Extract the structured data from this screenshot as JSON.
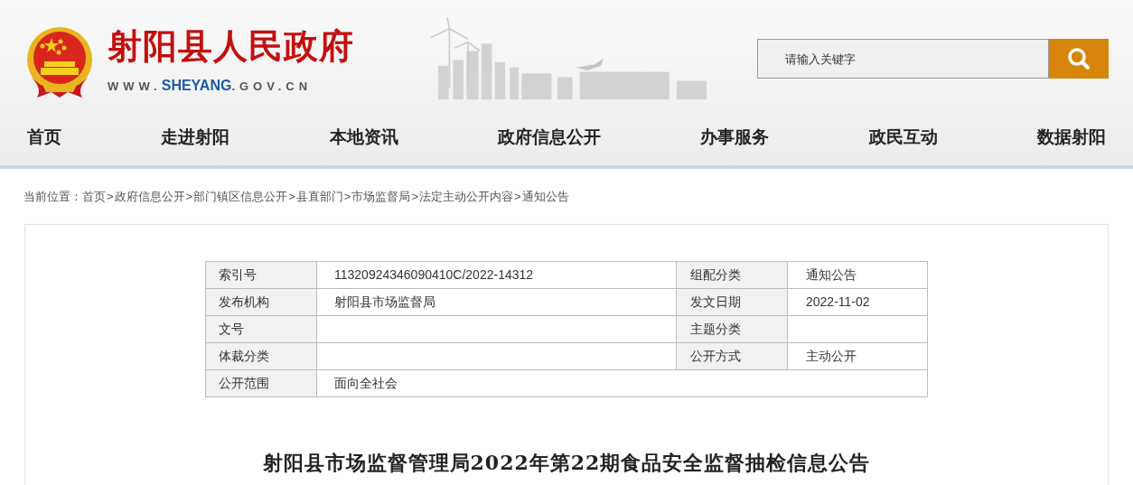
{
  "header": {
    "site_title": "射阳县人民政府",
    "url": {
      "prefix": "WWW.",
      "domain": "SHEYANG",
      "suffix": ".GOV.CN"
    },
    "search": {
      "placeholder": "请输入关键字"
    }
  },
  "nav": [
    {
      "label": "首页"
    },
    {
      "label": "走进射阳"
    },
    {
      "label": "本地资讯"
    },
    {
      "label": "政府信息公开"
    },
    {
      "label": "办事服务"
    },
    {
      "label": "政民互动"
    },
    {
      "label": "数据射阳"
    }
  ],
  "breadcrumb": {
    "label": "当前位置：",
    "items": [
      {
        "text": "首页"
      },
      {
        "sep": ">",
        "text": "政府信息公开"
      },
      {
        "sep": ">",
        "text": "部门镇区信息公开"
      },
      {
        "sep": ">",
        "text": "县直部门"
      },
      {
        "sep": ">",
        "text": "市场监督局"
      },
      {
        "sep": ">",
        "text": "法定主动公开内容"
      },
      {
        "sep": ">",
        "text": "通知公告"
      }
    ]
  },
  "info_table": [
    {
      "label1": "索引号",
      "value1": "11320924346090410C/2022-14312",
      "label2": "组配分类",
      "value2": "通知公告"
    },
    {
      "label1": "发布机构",
      "value1": "射阳县市场监督局",
      "label2": "发文日期",
      "value2": "2022-11-02"
    },
    {
      "label1": "文号",
      "label2": "主题分类"
    },
    {
      "label1": "体裁分类",
      "label2": "公开方式",
      "value2": "主动公开"
    },
    {
      "label1": "公开范围",
      "value1": "面向全社会"
    }
  ],
  "article_title": "射阳县市场监督管理局2022年第22期食品安全监督抽检信息公告"
}
